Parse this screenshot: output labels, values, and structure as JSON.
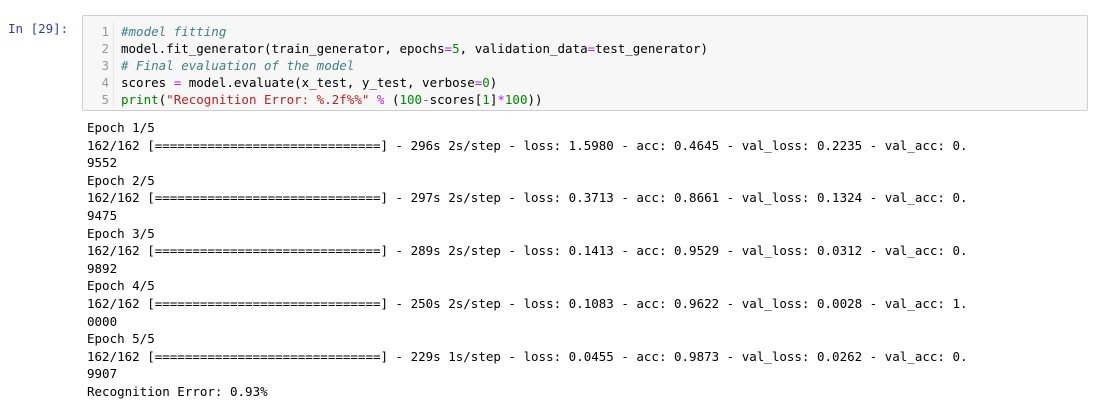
{
  "cell": {
    "prompt": "In [29]:",
    "code_lines": [
      {
        "num": "1",
        "segments": [
          {
            "t": "#model fitting",
            "c": "cm-comment"
          }
        ]
      },
      {
        "num": "2",
        "segments": [
          {
            "t": "model.fit_generator(train_generator, epochs",
            "c": ""
          },
          {
            "t": "=",
            "c": "cm-op"
          },
          {
            "t": "5",
            "c": "cm-number"
          },
          {
            "t": ", validation_data",
            "c": ""
          },
          {
            "t": "=",
            "c": "cm-op"
          },
          {
            "t": "test_generator)",
            "c": ""
          }
        ]
      },
      {
        "num": "3",
        "segments": [
          {
            "t": "# Final evaluation of the model",
            "c": "cm-comment"
          }
        ]
      },
      {
        "num": "4",
        "segments": [
          {
            "t": "scores ",
            "c": ""
          },
          {
            "t": "=",
            "c": "cm-op"
          },
          {
            "t": " model.evaluate(x_test, y_test, verbose",
            "c": ""
          },
          {
            "t": "=",
            "c": "cm-op"
          },
          {
            "t": "0",
            "c": "cm-number"
          },
          {
            "t": ")",
            "c": ""
          }
        ]
      },
      {
        "num": "5",
        "segments": [
          {
            "t": "print",
            "c": "cm-builtin"
          },
          {
            "t": "(",
            "c": ""
          },
          {
            "t": "\"Recognition Error: %.2f%%\"",
            "c": "cm-string"
          },
          {
            "t": " ",
            "c": ""
          },
          {
            "t": "%",
            "c": "cm-op"
          },
          {
            "t": " (",
            "c": ""
          },
          {
            "t": "100",
            "c": "cm-number"
          },
          {
            "t": "-",
            "c": "cm-op"
          },
          {
            "t": "scores[",
            "c": ""
          },
          {
            "t": "1",
            "c": "cm-number"
          },
          {
            "t": "]",
            "c": ""
          },
          {
            "t": "*",
            "c": "cm-op"
          },
          {
            "t": "100",
            "c": "cm-number"
          },
          {
            "t": "))",
            "c": ""
          }
        ]
      }
    ],
    "output_lines": [
      "Epoch 1/5",
      "162/162 [==============================] - 296s 2s/step - loss: 1.5980 - acc: 0.4645 - val_loss: 0.2235 - val_acc: 0.",
      "9552",
      "Epoch 2/5",
      "162/162 [==============================] - 297s 2s/step - loss: 0.3713 - acc: 0.8661 - val_loss: 0.1324 - val_acc: 0.",
      "9475",
      "Epoch 3/5",
      "162/162 [==============================] - 289s 2s/step - loss: 0.1413 - acc: 0.9529 - val_loss: 0.0312 - val_acc: 0.",
      "9892",
      "Epoch 4/5",
      "162/162 [==============================] - 250s 2s/step - loss: 0.1083 - acc: 0.9622 - val_loss: 0.0028 - val_acc: 1.",
      "0000",
      "Epoch 5/5",
      "162/162 [==============================] - 229s 1s/step - loss: 0.0455 - acc: 0.9873 - val_loss: 0.0262 - val_acc: 0.",
      "9907",
      "Recognition Error: 0.93%"
    ]
  },
  "colors": {
    "prompt": "#303f9f",
    "input_bg": "#f7f7f7",
    "input_border": "#cfcfcf",
    "comment": "#408080",
    "number": "#008800",
    "string": "#ba2121",
    "operator": "#aa22ff",
    "builtin": "#008000"
  }
}
